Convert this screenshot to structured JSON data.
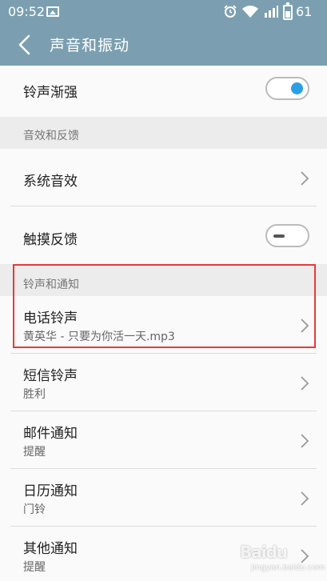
{
  "status_bar": {
    "time": "09:52",
    "battery_level": "61",
    "icons": [
      "image-icon",
      "alarm-icon",
      "wifi-icon",
      "signal-icon",
      "battery-icon"
    ]
  },
  "app_bar": {
    "title": "声音和振动",
    "back_icon": "back-arrow-icon"
  },
  "rows": {
    "ringtone_fade": {
      "title": "铃声渐强",
      "toggle_on": true
    },
    "section_effects": "音效和反馈",
    "system_sound": {
      "title": "系统音效"
    },
    "haptic": {
      "title": "触摸反馈",
      "toggle_on": false
    },
    "section_ringtones": "铃声和通知",
    "phone_ringtone": {
      "title": "电话铃声",
      "value": "黄英华 - 只要为你活一天.mp3"
    },
    "sms_tone": {
      "title": "短信铃声",
      "value": "胜利"
    },
    "mail_notice": {
      "title": "邮件通知",
      "value": "提醒"
    },
    "calendar_notice": {
      "title": "日历通知",
      "value": "门铃"
    },
    "other_notice": {
      "title": "其他通知",
      "value": "提醒"
    }
  },
  "colors": {
    "header": "#7b9fb0",
    "toggle_accent": "#2a9fe6",
    "highlight_border": "#e53b3b"
  },
  "watermark": {
    "text": "Baidu",
    "sub": "jingyan.baidu.com"
  }
}
